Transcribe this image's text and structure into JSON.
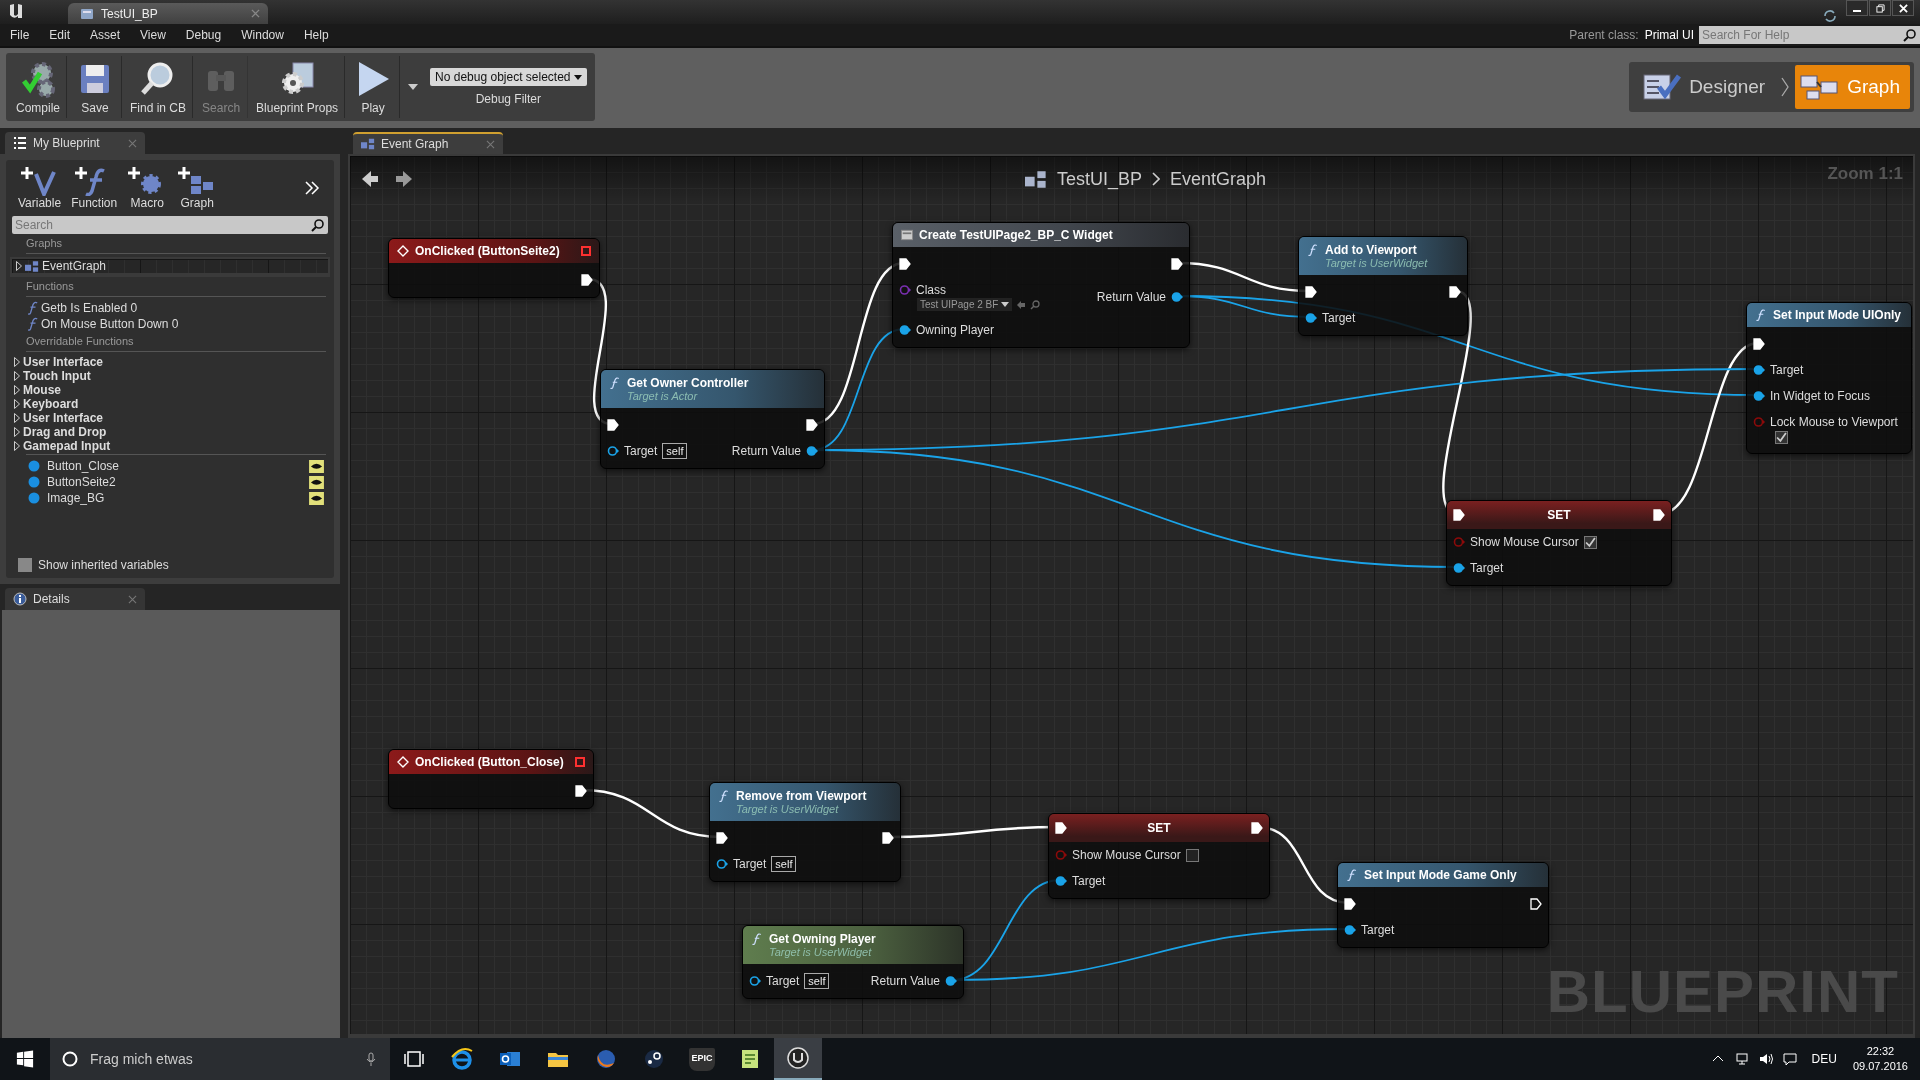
{
  "window": {
    "title": "TestUI_BP"
  },
  "menu": [
    "File",
    "Edit",
    "Asset",
    "View",
    "Debug",
    "Window",
    "Help"
  ],
  "parent_class": {
    "label": "Parent class:",
    "value": "Primal UI"
  },
  "help_search": {
    "placeholder": "Search For Help"
  },
  "toolbar": [
    {
      "label": "Compile",
      "kind": "compile",
      "disabled": false
    },
    {
      "label": "Save",
      "kind": "save",
      "disabled": false
    },
    {
      "label": "Find in CB",
      "kind": "find",
      "disabled": false
    },
    {
      "label": "Search",
      "kind": "search",
      "disabled": true
    },
    {
      "label": "Blueprint Props",
      "kind": "props",
      "disabled": false
    },
    {
      "label": "Play",
      "kind": "play",
      "disabled": false
    }
  ],
  "debug_filter": {
    "value": "No debug object selected",
    "label": "Debug Filter"
  },
  "modes": [
    {
      "label": "Designer",
      "kind": "designer",
      "selected": false
    },
    {
      "label": "Graph",
      "kind": "graph",
      "selected": true
    }
  ],
  "my_blueprint": {
    "tab": "My Blueprint",
    "actions": [
      {
        "label": "Variable",
        "kind": "variable"
      },
      {
        "label": "Function",
        "kind": "function"
      },
      {
        "label": "Macro",
        "kind": "macro"
      },
      {
        "label": "Graph",
        "kind": "graph"
      }
    ],
    "search": {
      "placeholder": "Search"
    },
    "sections": [
      {
        "title": "Graphs",
        "items": [
          {
            "label": "EventGraph",
            "kind": "graph"
          }
        ]
      },
      {
        "title": "Functions",
        "items": [
          {
            "label": "Getb Is Enabled 0",
            "kind": "function"
          },
          {
            "label": "On Mouse Button Down 0",
            "kind": "function"
          }
        ]
      },
      {
        "title": "Overridable Functions",
        "items": [
          {
            "label": "User Interface",
            "kind": "category"
          },
          {
            "label": "Touch Input",
            "kind": "category"
          },
          {
            "label": "Mouse",
            "kind": "category"
          },
          {
            "label": "Keyboard",
            "kind": "category"
          },
          {
            "label": "User Interface",
            "kind": "category"
          },
          {
            "label": "Drag and Drop",
            "kind": "category"
          },
          {
            "label": "Gamepad Input",
            "kind": "category"
          }
        ]
      },
      {
        "items": [
          {
            "label": "Button_Close",
            "kind": "variable"
          },
          {
            "label": "ButtonSeite2",
            "kind": "variable"
          },
          {
            "label": "Image_BG",
            "kind": "variable"
          }
        ]
      }
    ],
    "show_inherited": {
      "label": "Show inherited variables",
      "checked": false
    }
  },
  "details": {
    "tab": "Details"
  },
  "graph": {
    "tab": "Event Graph",
    "breadcrumb": [
      "TestUI_BP",
      "EventGraph"
    ],
    "zoom": "Zoom 1:1",
    "watermark": "BLUEPRINT",
    "nodes": [
      {
        "title": "OnClicked (ButtonSeite2)",
        "kind": "event",
        "rows": [
          {
            "out": {
              "kind": "exec",
              "connected": true
            }
          }
        ]
      },
      {
        "title": "Get Owner Controller",
        "subtitle": "Target is Actor",
        "kind": "function",
        "rows": [
          {
            "in": {
              "kind": "exec",
              "connected": true
            },
            "out": {
              "kind": "exec",
              "connected": true
            }
          },
          {
            "in": {
              "kind": "object",
              "label": "Target",
              "default": "self",
              "connected": false
            },
            "out": {
              "kind": "object",
              "label": "Return Value",
              "connected": true
            }
          }
        ]
      },
      {
        "title": "Create TestUIPage2_BP_C Widget",
        "kind": "widget",
        "rows": [
          {
            "in": {
              "kind": "exec",
              "connected": true
            },
            "out": {
              "kind": "exec",
              "connected": true
            }
          },
          {
            "in": {
              "kind": "class",
              "label": "Class",
              "dropdown": "Test UIPage 2 BF",
              "connected": false
            },
            "out": {
              "kind": "object",
              "label": "Return Value",
              "connected": true
            }
          },
          {
            "in": {
              "kind": "object",
              "label": "Owning Player",
              "connected": true
            }
          }
        ]
      },
      {
        "title": "Add to Viewport",
        "subtitle": "Target is UserWidget",
        "kind": "function",
        "rows": [
          {
            "in": {
              "kind": "exec",
              "connected": true
            },
            "out": {
              "kind": "exec",
              "connected": true
            }
          },
          {
            "in": {
              "kind": "object",
              "label": "Target",
              "connected": true
            }
          }
        ]
      },
      {
        "title": "Set Input Mode UIOnly",
        "kind": "function",
        "rows": [
          {
            "in": {
              "kind": "exec",
              "connected": true
            }
          },
          {
            "in": {
              "kind": "object",
              "label": "Target",
              "connected": true
            }
          },
          {
            "in": {
              "kind": "object",
              "label": "In Widget to Focus",
              "connected": true
            }
          },
          {
            "in": {
              "kind": "bool",
              "label": "Lock Mouse to Viewport",
              "connected": false,
              "checked": true
            }
          }
        ]
      },
      {
        "title": "SET",
        "kind": "set",
        "rows": [
          {
            "in": {
              "kind": "exec",
              "connected": true
            },
            "out": {
              "kind": "exec",
              "connected": true
            }
          },
          {
            "in": {
              "kind": "bool",
              "label": "Show Mouse Cursor",
              "connected": false,
              "checked": true
            }
          },
          {
            "in": {
              "kind": "object",
              "label": "Target",
              "connected": true
            }
          }
        ]
      },
      {
        "title": "OnClicked (Button_Close)",
        "kind": "event",
        "rows": [
          {
            "out": {
              "kind": "exec",
              "connected": true
            }
          }
        ]
      },
      {
        "title": "Remove from Viewport",
        "subtitle": "Target is UserWidget",
        "kind": "function",
        "rows": [
          {
            "in": {
              "kind": "exec",
              "connected": true
            },
            "out": {
              "kind": "exec",
              "connected": true
            }
          },
          {
            "in": {
              "kind": "object",
              "label": "Target",
              "default": "self",
              "connected": false
            }
          }
        ]
      },
      {
        "title": "SET",
        "kind": "set",
        "rows": [
          {
            "in": {
              "kind": "exec",
              "connected": true
            },
            "out": {
              "kind": "exec",
              "connected": true
            }
          },
          {
            "in": {
              "kind": "bool",
              "label": "Show Mouse Cursor",
              "connected": false,
              "checked": false
            }
          },
          {
            "in": {
              "kind": "object",
              "label": "Target",
              "connected": true
            }
          }
        ]
      },
      {
        "title": "Set Input Mode Game Only",
        "kind": "function",
        "rows": [
          {
            "in": {
              "kind": "exec",
              "connected": true
            },
            "out": {
              "kind": "exec",
              "connected": false
            }
          },
          {
            "in": {
              "kind": "object",
              "label": "Target",
              "connected": true
            }
          }
        ]
      },
      {
        "title": "Get Owning Player",
        "subtitle": "Target is UserWidget",
        "kind": "pure",
        "rows": [
          {
            "in": {
              "kind": "object",
              "label": "Target",
              "default": "self",
              "connected": false
            },
            "out": {
              "kind": "object",
              "label": "Return Value",
              "connected": true
            }
          }
        ]
      }
    ]
  },
  "taskbar": {
    "search": {
      "placeholder": "Frag mich etwas"
    },
    "apps": [
      {
        "kind": "taskview",
        "selected": false
      },
      {
        "kind": "browser",
        "selected": false
      },
      {
        "kind": "mail",
        "selected": false
      },
      {
        "kind": "folder",
        "selected": false
      },
      {
        "kind": "firefox",
        "selected": false
      },
      {
        "kind": "steam",
        "selected": false
      },
      {
        "kind": "epic",
        "label": "EPIC",
        "selected": false
      },
      {
        "kind": "notes",
        "selected": false
      },
      {
        "kind": "unreal",
        "selected": true
      }
    ],
    "language": "DEU",
    "time": "22:32",
    "date": "09.07.2016"
  }
}
